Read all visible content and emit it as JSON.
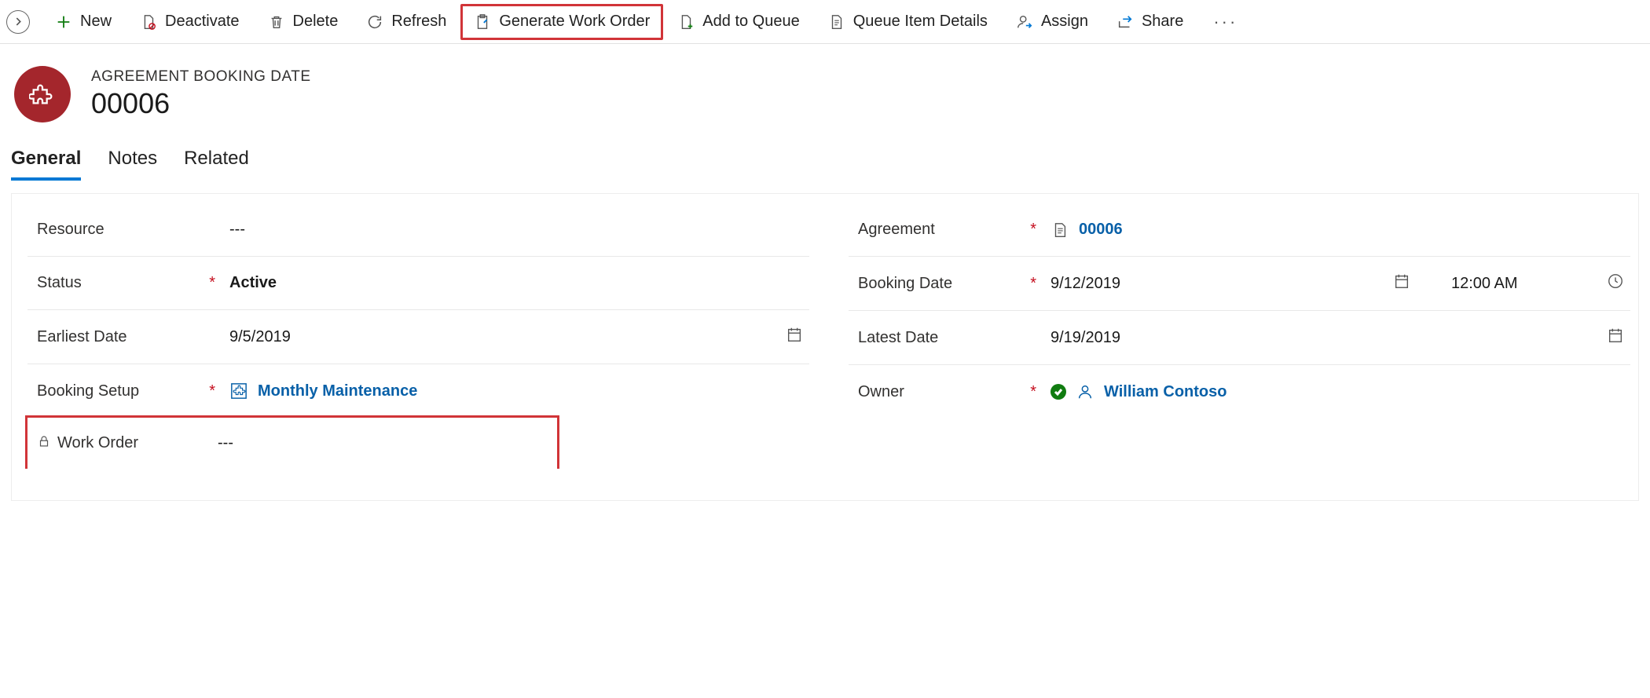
{
  "commandBar": {
    "new": "New",
    "deactivate": "Deactivate",
    "delete": "Delete",
    "refresh": "Refresh",
    "generateWorkOrder": "Generate Work Order",
    "addToQueue": "Add to Queue",
    "queueItemDetails": "Queue Item Details",
    "assign": "Assign",
    "share": "Share"
  },
  "header": {
    "entityType": "AGREEMENT BOOKING DATE",
    "recordName": "00006"
  },
  "tabs": {
    "general": "General",
    "notes": "Notes",
    "related": "Related"
  },
  "fields": {
    "resource": {
      "label": "Resource",
      "value": "---"
    },
    "status": {
      "label": "Status",
      "value": "Active"
    },
    "earliestDate": {
      "label": "Earliest Date",
      "value": "9/5/2019"
    },
    "bookingSetup": {
      "label": "Booking Setup",
      "value": "Monthly Maintenance"
    },
    "workOrder": {
      "label": "Work Order",
      "value": "---"
    },
    "agreement": {
      "label": "Agreement",
      "value": "00006"
    },
    "bookingDate": {
      "label": "Booking Date",
      "date": "9/12/2019",
      "time": "12:00 AM"
    },
    "latestDate": {
      "label": "Latest Date",
      "value": "9/19/2019"
    },
    "owner": {
      "label": "Owner",
      "value": "William Contoso"
    }
  }
}
